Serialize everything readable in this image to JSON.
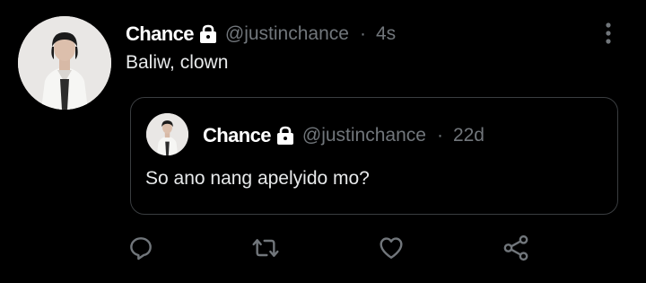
{
  "tweet": {
    "display_name": "Chance",
    "handle": "@justinchance",
    "separator": "·",
    "time": "4s",
    "text": "Baliw, clown",
    "protected_icon": "lock-icon",
    "more_icon": "more-vertical-icon"
  },
  "quoted_tweet": {
    "display_name": "Chance",
    "handle": "@justinchance",
    "separator": "·",
    "time": "22d",
    "text": "So ano nang apelyido mo?",
    "protected_icon": "lock-icon"
  },
  "actions": [
    {
      "name": "reply",
      "icon": "reply-icon"
    },
    {
      "name": "retweet",
      "icon": "retweet-icon"
    },
    {
      "name": "like",
      "icon": "heart-icon"
    },
    {
      "name": "share",
      "icon": "share-icon"
    }
  ],
  "colors": {
    "background": "#000000",
    "primary_text": "#ffffff",
    "secondary_text": "#71767b",
    "border": "#3a3d40",
    "icon": "#71767b"
  }
}
